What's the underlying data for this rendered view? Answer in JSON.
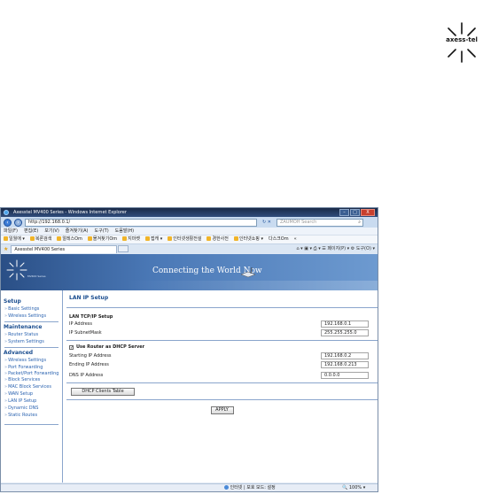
{
  "logo": {
    "text": "axess-tel"
  },
  "browser": {
    "title": "Axesstel MV400 Series - Windows Internet Explorer",
    "window_buttons": {
      "minimize": "–",
      "maximize": "□",
      "close": "X"
    },
    "address": "http://192.168.0.1/",
    "search_placeholder": "ZAUMOH Search",
    "menu": [
      "파일(F)",
      "편집(E)",
      "보기(V)",
      "즐겨찾기(A)",
      "도구(T)",
      "도움말(H)"
    ],
    "favorites": [
      "일월애 ▾",
      "복론검색",
      "알레스Om",
      "몰겨찾기Om",
      "지마켓",
      "접캐 ▾",
      "인터넷생활전설",
      "경한사전",
      "인터넷쇼핑 ▾",
      "다스크Om",
      "«"
    ],
    "tab_label": "Axesstel MV400 Series",
    "command_bar": "⌂ ▾  ▣ ▾  ⎙ ▾  ☰ 페이지(P) ▾  ⚙ 도구(O) ▾"
  },
  "router": {
    "banner_tagline": "Connecting the World Now",
    "banner_series": "MV400 Series",
    "sidebar": {
      "setup_title": "Setup",
      "setup_items": [
        "Basic Settings",
        "Wireless Settings"
      ],
      "maintenance_title": "Maintenance",
      "maintenance_items": [
        "Router Status",
        "System Settings"
      ],
      "advanced_title": "Advanced",
      "advanced_items": [
        "Wireless Settings",
        "Port Forwarding",
        "Packet/Port Forwarding",
        "Block Services",
        "MAC Block Services",
        "WAN Setup",
        "LAN IP Setup",
        "Dynamic DNS",
        "Static Routes"
      ]
    },
    "content": {
      "page_title": "LAN IP Setup",
      "lan_tcpip_title": "LAN TCP/IP Setup",
      "ip_label": "IP Address",
      "ip_value": "192.168.0.1",
      "mask_label": "IP SubnetMask",
      "mask_value": "255.255.255.0",
      "dhcp_checkbox_label": "Use Router as DHCP Server",
      "dhcp_checked": true,
      "start_label": "Starting IP Address",
      "start_value": "192.168.0.2",
      "end_label": "Ending IP Address",
      "end_value": "192.168.0.213",
      "dns_label": "DNS IP Address",
      "dns_value": "0.0.0.0",
      "dhcp_table_button": "DHCP Clients Table",
      "apply_button": "APPLY"
    }
  },
  "status": {
    "zone": "인터넷 | 보호 모드: 설정",
    "zoom": "100%"
  }
}
